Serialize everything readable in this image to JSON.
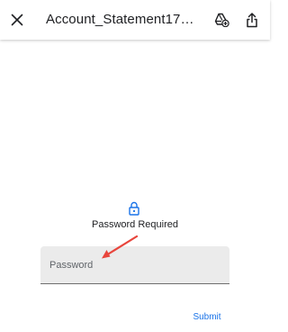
{
  "header": {
    "title": "Account_Statement173250...",
    "close_icon": "close-icon",
    "drive_icon": "add-to-drive-icon",
    "share_icon": "share-icon"
  },
  "prompt": {
    "icon": "lock-icon",
    "label": "Password Required"
  },
  "password_field": {
    "placeholder": "Password",
    "value": ""
  },
  "annotation": {
    "icon": "arrow-icon",
    "color": "#e8453c"
  },
  "actions": {
    "submit_label": "Submit"
  },
  "colors": {
    "accent": "#1a73e8",
    "field_bg": "#ebebeb",
    "text": "#202124"
  }
}
